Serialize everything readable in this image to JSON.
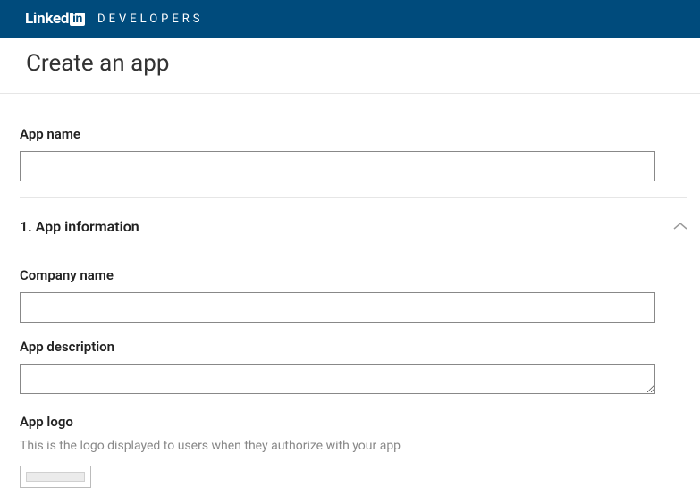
{
  "brand": {
    "linked_text": "Linked",
    "in_text": "in",
    "developers_label": "DEVELOPERS"
  },
  "page": {
    "title": "Create an app"
  },
  "form": {
    "app_name": {
      "label": "App name",
      "value": ""
    },
    "section1": {
      "title": "1. App information"
    },
    "company_name": {
      "label": "Company name",
      "value": ""
    },
    "app_description": {
      "label": "App description",
      "value": ""
    },
    "app_logo": {
      "label": "App logo",
      "help": "This is the logo displayed to users when they authorize with your app"
    }
  }
}
